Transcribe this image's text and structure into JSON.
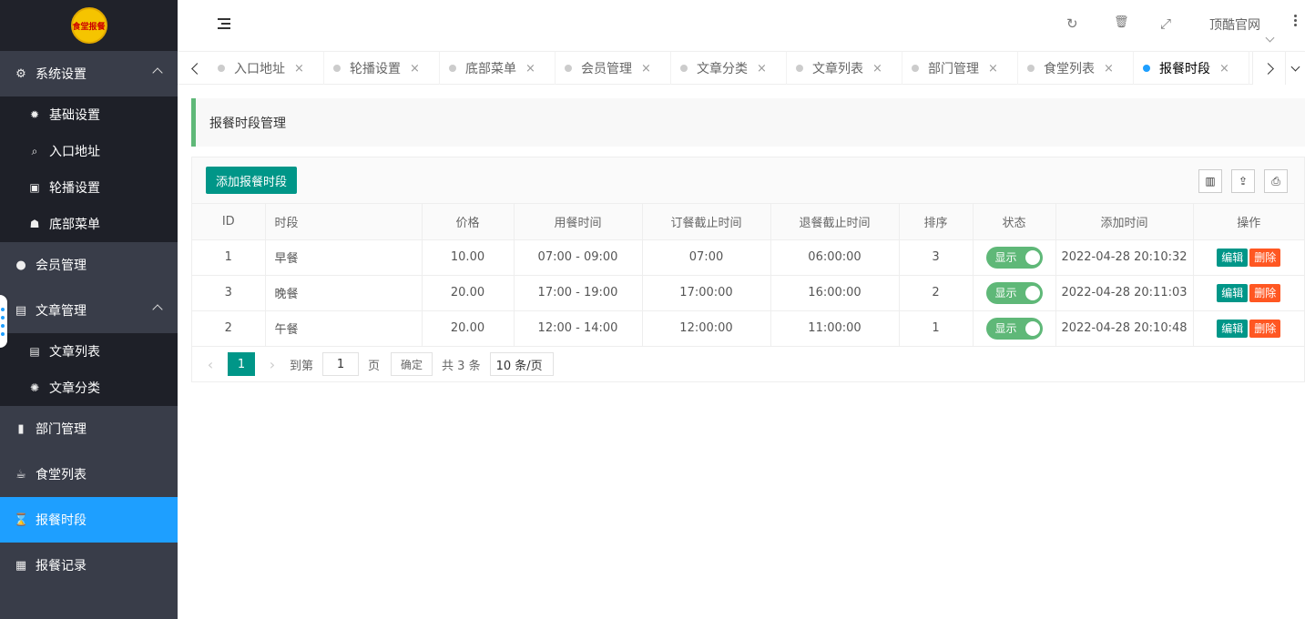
{
  "sidebar": {
    "logo_text": "食堂报餐",
    "items": [
      {
        "label": "系统设置",
        "icon": "gears-icon",
        "glyph": "⚙",
        "expanded": true
      },
      {
        "label": "基础设置",
        "icon": "gear-icon",
        "glyph": "✹"
      },
      {
        "label": "入口地址",
        "icon": "search-icon",
        "glyph": "⌕"
      },
      {
        "label": "轮播设置",
        "icon": "image-icon",
        "glyph": "▣"
      },
      {
        "label": "底部菜单",
        "icon": "sitemap-icon",
        "glyph": "☗"
      },
      {
        "label": "会员管理",
        "icon": "user-icon",
        "glyph": "●"
      },
      {
        "label": "文章管理",
        "icon": "newspaper-icon",
        "glyph": "▤",
        "expanded": true
      },
      {
        "label": "文章列表",
        "icon": "newspaper-icon",
        "glyph": "▤"
      },
      {
        "label": "文章分类",
        "icon": "asterisk-icon",
        "glyph": "✺"
      },
      {
        "label": "部门管理",
        "icon": "mobile-icon",
        "glyph": "▮"
      },
      {
        "label": "食堂列表",
        "icon": "coffee-icon",
        "glyph": "☕"
      },
      {
        "label": "报餐时段",
        "icon": "hourglass-icon",
        "glyph": "⌛",
        "active": true
      },
      {
        "label": "报餐记录",
        "icon": "table-icon",
        "glyph": "▦"
      }
    ]
  },
  "header": {
    "site_link": "顶酷官网",
    "icons": {
      "refresh": "↻",
      "delete": "🗑",
      "fullscreen": "⤢"
    }
  },
  "tabs": {
    "items": [
      {
        "label": "入口地址"
      },
      {
        "label": "轮播设置"
      },
      {
        "label": "底部菜单"
      },
      {
        "label": "会员管理"
      },
      {
        "label": "文章分类"
      },
      {
        "label": "文章列表"
      },
      {
        "label": "部门管理"
      },
      {
        "label": "食堂列表"
      },
      {
        "label": "报餐时段",
        "active": true
      }
    ],
    "close_glyph": "×"
  },
  "page": {
    "title": "报餐时段管理",
    "add_button": "添加报餐时段",
    "tool_icons": {
      "columns": "▥",
      "export": "⇪",
      "print": "⎙"
    }
  },
  "table": {
    "headers": [
      "ID",
      "时段",
      "价格",
      "用餐时间",
      "订餐截止时间",
      "退餐截止时间",
      "排序",
      "状态",
      "添加时间",
      "操作"
    ],
    "rows": [
      {
        "id": "1",
        "name": "早餐",
        "price": "10.00",
        "meal_time": "07:00 - 09:00",
        "order_deadline": "07:00",
        "cancel_deadline": "06:00:00",
        "sort": "3",
        "status": "显示",
        "added": "2022-04-28 20:10:32"
      },
      {
        "id": "3",
        "name": "晚餐",
        "price": "20.00",
        "meal_time": "17:00 - 19:00",
        "order_deadline": "17:00:00",
        "cancel_deadline": "16:00:00",
        "sort": "2",
        "status": "显示",
        "added": "2022-04-28 20:11:03"
      },
      {
        "id": "2",
        "name": "午餐",
        "price": "20.00",
        "meal_time": "12:00 - 14:00",
        "order_deadline": "12:00:00",
        "cancel_deadline": "11:00:00",
        "sort": "1",
        "status": "显示",
        "added": "2022-04-28 20:10:48"
      }
    ],
    "edit_label": "编辑",
    "delete_label": "删除"
  },
  "pager": {
    "prev": "‹",
    "current": "1",
    "next": "›",
    "goto_label": "到第",
    "goto_value": "1",
    "page_unit": "页",
    "confirm": "确定",
    "total": "共 3 条",
    "per_page": "10 条/页"
  },
  "colors": {
    "sidebar": "#393d49",
    "active": "#1e9fff",
    "primary": "#009688",
    "danger": "#ff5722",
    "switch_on": "#5fb878"
  }
}
